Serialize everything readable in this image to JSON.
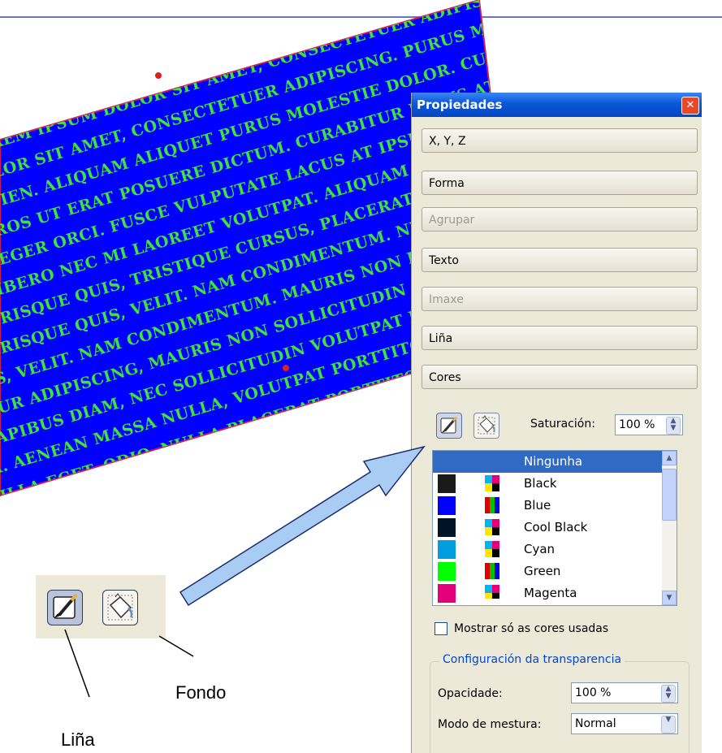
{
  "canvas": {
    "lines": [
      "LOREM IPSUM DOLOR SIT AMET, CONSECTETUER ADIPISCING ELIT. DUIS",
      "DOLOR SIT AMET, CONSECTETUER ADIPISCING. PURUS MOLESTIE DOLOR",
      "SAPIEN. ALIQUAM ALIQUET PURUS MOLESTIE DOLOR. CURABITUR ARCU",
      "S EROS UT ERAT POSUERE DICTUM. CURABITUR LACUS AT IPSUM.",
      "INTEGER ORCI. FUSCE VULPUTATE LACUS AT IPSUM. ALIQUAM EROS",
      "N LIBERO NEC MI LAOREET VOLUTPAT. ALIQUAM EROS PLACERAT",
      "ELERISQUE QUIS, TRISTIQUE CURSUS, PLACERAT. NULLA UT MAGNA",
      "ELERISQUE QUIS, VELIT. NAM CONDIMENTUM. NULLA UT MAGNA ALIQUAM",
      "LLIS, VELIT. NAM CONDIMENTUM. MAURIS NON DICTUM ALIQUAM ERAT",
      "BITUR ADIPISCING, MAURIS NON SOLLICITUDIN QUAM ERAT EU, SED",
      "S DAPIBUS DIAM, NEC SOLLICITUDIN VOLUTPAT EU, SED PORTTITOR",
      "ULA. AENEAN MASSA NULLA, VOLUTPAT PORTTITOR PLACERAT",
      "INGILLA EGET. ODIO. NULLA PLACERAT PORTTITOR"
    ]
  },
  "panel": {
    "title": "Propiedades",
    "close_glyph": "✕",
    "sections": [
      {
        "label": "X, Y, Z",
        "disabled": false
      },
      {
        "label": "Forma",
        "disabled": false
      },
      {
        "label": "Agrupar",
        "disabled": true
      },
      {
        "label": "Texto",
        "disabled": false
      },
      {
        "label": "Imaxe",
        "disabled": true
      },
      {
        "label": "Liña",
        "disabled": false
      },
      {
        "label": "Cores",
        "disabled": false
      }
    ],
    "saturation_label": "Saturación:",
    "saturation_value": "100 %",
    "colors": [
      {
        "name": "Ningunha",
        "swatch": "",
        "selected": true
      },
      {
        "name": "Black",
        "swatch": "#1a1a1a",
        "selected": false
      },
      {
        "name": "Blue",
        "swatch": "#0000ff",
        "selected": false
      },
      {
        "name": "Cool Black",
        "swatch": "#001428",
        "selected": false
      },
      {
        "name": "Cyan",
        "swatch": "#009ee0",
        "selected": false
      },
      {
        "name": "Green",
        "swatch": "#00ff00",
        "selected": false
      },
      {
        "name": "Magenta",
        "swatch": "#e3007a",
        "selected": false
      }
    ],
    "show_used_label": "Mostrar só as cores usadas",
    "transparency_group": "Configuración da transparencia",
    "opacity_label": "Opacidade:",
    "opacity_value": "100 %",
    "blend_label": "Modo de mestura:",
    "blend_value": "Normal"
  },
  "annotations": {
    "fondo": "Fondo",
    "lina": "Liña"
  },
  "colors": {
    "canvas_fill": "#0000ff",
    "canvas_text": "#3fe23f",
    "selection_blue": "#316ac5",
    "title_blue": "#0a57d8",
    "arrow_fill": "#a8ccf4"
  }
}
